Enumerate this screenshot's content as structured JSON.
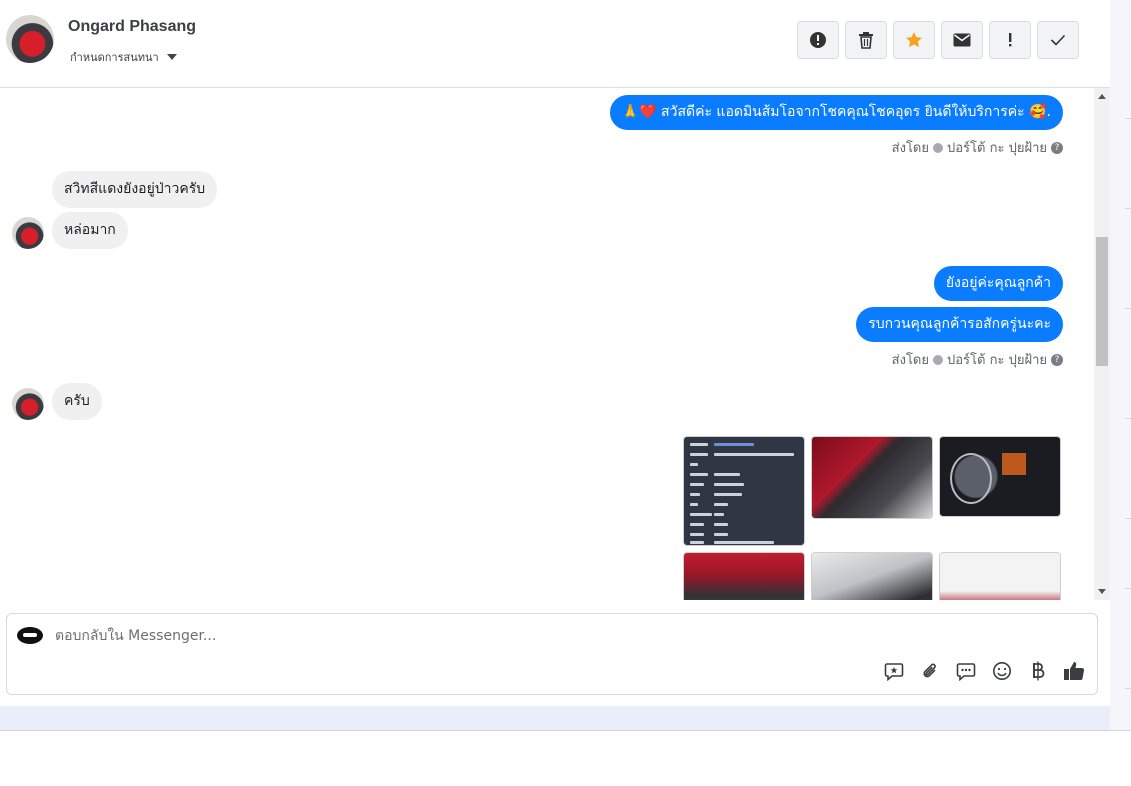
{
  "header": {
    "contact_name": "Ongard Phasang",
    "conversation_label": "กำหนดการสนทนา",
    "actions": [
      {
        "name": "spam-button",
        "icon": "alert-circle-icon",
        "glyph": "!"
      },
      {
        "name": "delete-button",
        "icon": "trash-icon",
        "glyph": "🗑"
      },
      {
        "name": "star-button",
        "icon": "star-icon",
        "glyph": "★"
      },
      {
        "name": "mark-unread-button",
        "icon": "envelope-icon",
        "glyph": "✉"
      },
      {
        "name": "important-button",
        "icon": "exclamation-icon",
        "glyph": "!"
      },
      {
        "name": "done-button",
        "icon": "check-icon",
        "glyph": "✓"
      }
    ],
    "star_color": "#f6a21e"
  },
  "messages": {
    "greeting": "🙏❤️ สวัสดีค่ะ แอดมินส้มโอจากโชคคุณโชคอุดร ยินดีให้บริการค่ะ 🥰.",
    "sent_by_1": "ส่งโดย",
    "sent_by_name_1": "ปอร์โต้ กะ ปุยฝ้าย",
    "incoming_1": "สวิทสีแดงยังอยู่ป่าวครับ",
    "incoming_2": "หล่อมาก",
    "outgoing_1": "ยังอยู่ค่ะคุณลูกค้า",
    "outgoing_2": "รบกวนคุณลูกค้ารอสักครู่นะคะ",
    "sent_by_2": "ส่งโดย",
    "sent_by_name_2": "ปอร์โต้ กะ ปุยฝ้าย",
    "incoming_3": "ครับ",
    "help_glyph": "?",
    "outgoing_color": "#0a7cff",
    "incoming_color": "#f0f0f0"
  },
  "reply": {
    "placeholder": "ตอบกลับใน Messenger...",
    "tools": [
      {
        "name": "saved-reply-button",
        "icon": "chat-star-icon",
        "glyph": "✪"
      },
      {
        "name": "attach-button",
        "icon": "paperclip-icon",
        "glyph": "📎"
      },
      {
        "name": "quick-reply-button",
        "icon": "chat-dots-icon",
        "glyph": "💬"
      },
      {
        "name": "emoji-button",
        "icon": "smiley-icon",
        "glyph": "☺"
      },
      {
        "name": "payment-button",
        "icon": "baht-icon",
        "glyph": "฿"
      },
      {
        "name": "like-button",
        "icon": "thumbs-up-icon",
        "glyph": "👍"
      }
    ]
  }
}
